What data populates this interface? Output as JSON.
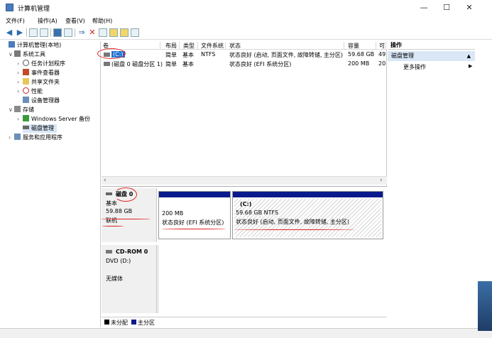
{
  "window": {
    "title": "计算机管理",
    "minimize": "—",
    "maximize": "☐",
    "close": "✕"
  },
  "menu": [
    "文件(F)",
    "操作(A)",
    "查看(V)",
    "帮助(H)"
  ],
  "tree": {
    "root": "计算机管理(本地)",
    "system_tools": "系统工具",
    "task_scheduler": "任务计划程序",
    "event_viewer": "事件查看器",
    "shared_folders": "共享文件夹",
    "performance": "性能",
    "device_manager": "设备管理器",
    "storage": "存储",
    "windows_server_backup": "Windows Server 备份",
    "disk_management": "磁盘管理",
    "services_apps": "服务和应用程序"
  },
  "volumes": {
    "headers": [
      "卷",
      "布局",
      "类型",
      "文件系统",
      "状态",
      "容量",
      "可"
    ],
    "rows": [
      [
        "(C:)",
        "简单",
        "基本",
        "NTFS",
        "状态良好 (启动, 页面文件, 故障转储, 主分区)",
        "59.68 GB",
        "49"
      ],
      [
        "(磁盘 0 磁盘分区 1)",
        "简单",
        "基本",
        "",
        "状态良好 (EFI 系统分区)",
        "200 MB",
        "20"
      ]
    ]
  },
  "disk0": {
    "name": "磁盘 0",
    "type": "基本",
    "size": "59.88 GB",
    "status": "联机",
    "partitions": [
      {
        "label": "",
        "size": "200 MB",
        "status": "状态良好 (EFI 系统分区)"
      },
      {
        "label": "(C:)",
        "size": "59.68 GB NTFS",
        "status": "状态良好 (启动, 页面文件, 故障转储, 主分区)"
      }
    ]
  },
  "cdrom0": {
    "name": "CD-ROM 0",
    "type": "DVD (D:)",
    "status": "无媒体"
  },
  "legend": {
    "unallocated": "未分配",
    "primary": "主分区"
  },
  "actions": {
    "header": "操作",
    "selected": "磁盘管理",
    "more": "更多操作"
  },
  "colors": {
    "primary_partition": "#0a1a8c",
    "selection": "#d9e7f7",
    "annotation": "#e02020"
  }
}
